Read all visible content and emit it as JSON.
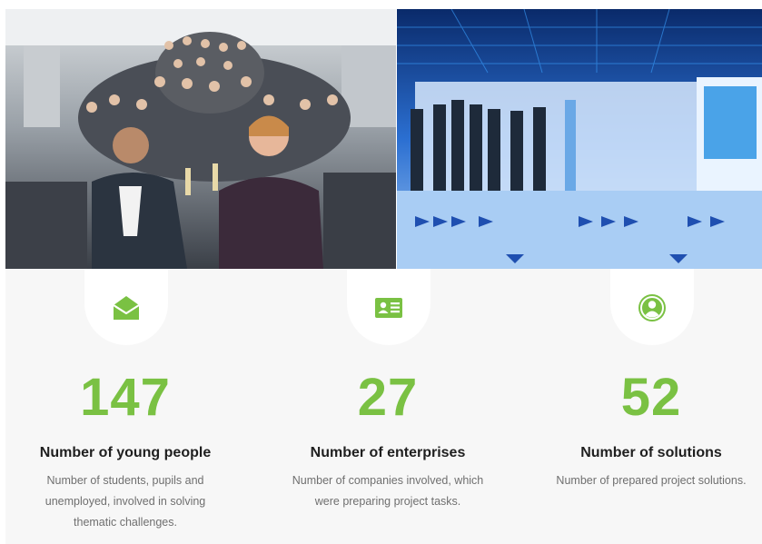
{
  "photos": {
    "left": {
      "icon": "event-group-photo",
      "description_name": "group-photo"
    },
    "right": {
      "icon": "presentation-room-photo",
      "description_name": "room-photo"
    }
  },
  "colors": {
    "accent": "#7ac143",
    "title": "#1f1f1f",
    "text": "#6f6f6f",
    "section_bg": "#f7f7f7"
  },
  "stats": [
    {
      "icon": "envelope-icon",
      "number": "147",
      "title": "Number of young people",
      "description": "Number of students, pupils and unemployed, involved in solving thematic challenges."
    },
    {
      "icon": "id-card-icon",
      "number": "27",
      "title": "Number of enterprises",
      "description": "Number of companies involved, which were preparing project tasks."
    },
    {
      "icon": "user-circle-icon",
      "number": "52",
      "title": "Number of solutions",
      "description": "Number of prepared project solutions."
    }
  ]
}
